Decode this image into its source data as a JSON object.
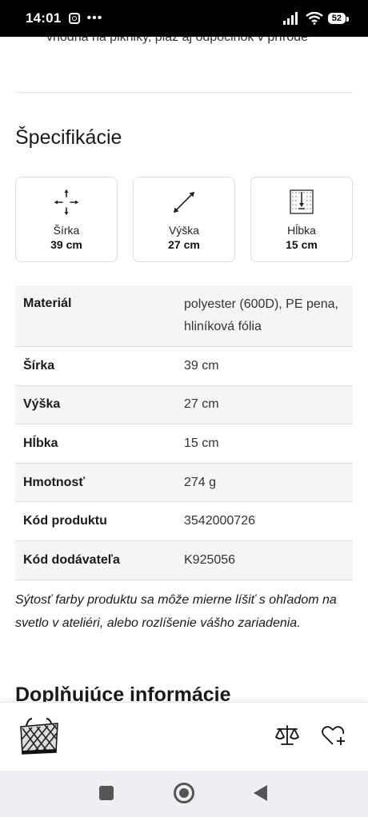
{
  "status_bar": {
    "time": "14:01",
    "battery": "52"
  },
  "previous_text": "vhodná na pikniky, pláž aj odpočinok v prírode",
  "specs": {
    "title": "Špecifikácie",
    "cards": [
      {
        "icon": "width-arrows-icon",
        "label": "Šírka",
        "value": "39 cm"
      },
      {
        "icon": "height-diagonal-icon",
        "label": "Výška",
        "value": "27 cm"
      },
      {
        "icon": "depth-icon",
        "label": "Hĺbka",
        "value": "15 cm"
      }
    ],
    "rows": [
      {
        "key": "Materiál",
        "value": "polyester (600D), PE pena, hliníková fólia"
      },
      {
        "key": "Šírka",
        "value": "39 cm"
      },
      {
        "key": "Výška",
        "value": "27 cm"
      },
      {
        "key": "Hĺbka",
        "value": "15 cm"
      },
      {
        "key": "Hmotnosť",
        "value": "274 g"
      },
      {
        "key": "Kód produktu",
        "value": "3542000726"
      },
      {
        "key": "Kód dodávateľa",
        "value": "K925056"
      }
    ],
    "note": "Sýtosť farby produktu sa môže mierne líšiť s ohľadom na svetlo v ateliéri, alebo rozlíšenie vášho zariadenia."
  },
  "next_section_title": "Doplňujúce informácie",
  "bottom_bar": {
    "thumbnail": "cooler-bag-thumbnail",
    "compare_icon": "scale-compare-icon",
    "wishlist_icon": "heart-plus-icon"
  },
  "nav": {
    "recents": "square-icon",
    "home": "circle-icon",
    "back": "triangle-back-icon"
  }
}
